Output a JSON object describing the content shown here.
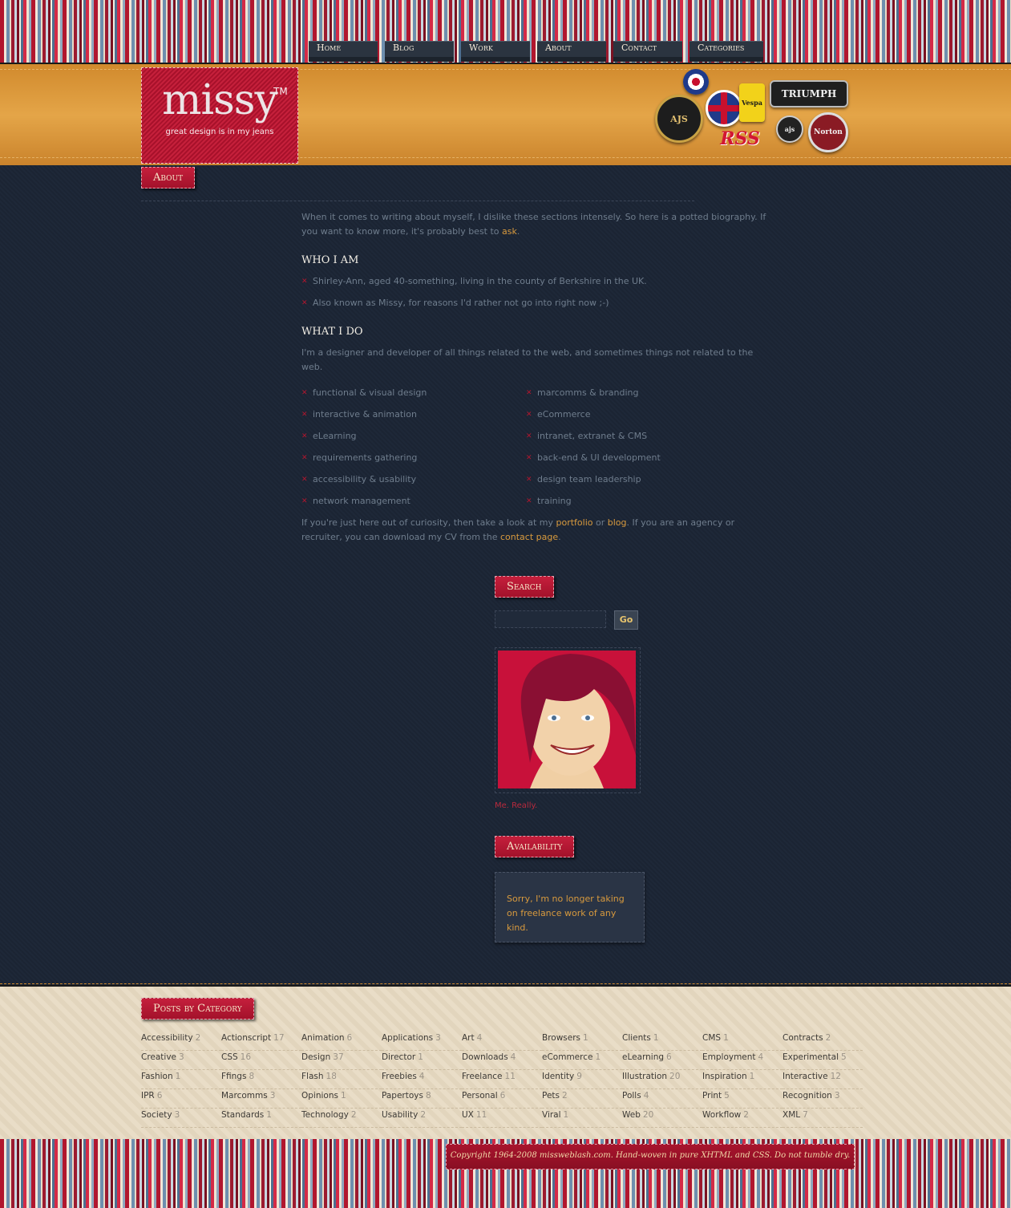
{
  "nav": [
    "Home",
    "Blog",
    "Work",
    "About",
    "Contact",
    "Categories"
  ],
  "logo": {
    "word": "missy",
    "tm": "TM",
    "tagline": "great design is in my jeans"
  },
  "badges": {
    "triumph": "TRIUMPH",
    "rss": "RSS",
    "norton": "Norton",
    "ajs": "AJS",
    "vespa": "Vespa"
  },
  "page_title": "About",
  "intro": {
    "text": "When it comes to writing about myself, I dislike these sections intensely. So here is a potted biography. If you want to know more, it's probably best to ",
    "link": "ask",
    "after": "."
  },
  "who": {
    "heading": "WHO I AM",
    "items": [
      "Shirley-Ann, aged 40-something, living in the county of Berkshire in the UK.",
      "Also known as Missy, for reasons I'd rather not go into right now ;-)"
    ]
  },
  "what": {
    "heading": "WHAT I DO",
    "text": "I'm a designer and developer of all things related to the web, and sometimes things not related to the web.",
    "left": [
      "functional & visual design",
      "interactive & animation",
      "eLearning",
      "requirements gathering",
      "accessibility & usability",
      "network management"
    ],
    "right": [
      "marcomms & branding",
      "eCommerce",
      "intranet, extranet & CMS",
      "back-end & UI development",
      "design team leadership",
      "training"
    ]
  },
  "outro": {
    "t1": "If you're just here out of curiosity, then take a look at my ",
    "l1": "portfolio",
    "t2": " or ",
    "l2": "blog",
    "t3": ". If you are an agency or recruiter, you can download my CV from the ",
    "l3": "contact page",
    "t4": "."
  },
  "sidebar": {
    "search_title": "Search",
    "go": "Go",
    "caption": "Me. Really.",
    "avail_title": "Availability",
    "avail_text": "Sorry, I'm no longer taking on freelance work of any kind."
  },
  "categories_title": "Posts by Category",
  "categories": [
    [
      "Accessibility",
      "2"
    ],
    [
      "Actionscript",
      "17"
    ],
    [
      "Animation",
      "6"
    ],
    [
      "Applications",
      "3"
    ],
    [
      "Art",
      "4"
    ],
    [
      "Browsers",
      "1"
    ],
    [
      "Clients",
      "1"
    ],
    [
      "CMS",
      "1"
    ],
    [
      "Contracts",
      "2"
    ],
    [
      "Creative",
      "3"
    ],
    [
      "CSS",
      "16"
    ],
    [
      "Design",
      "37"
    ],
    [
      "Director",
      "1"
    ],
    [
      "Downloads",
      "4"
    ],
    [
      "eCommerce",
      "1"
    ],
    [
      "eLearning",
      "6"
    ],
    [
      "Employment",
      "4"
    ],
    [
      "Experimental",
      "5"
    ],
    [
      "Fashion",
      "1"
    ],
    [
      "Ffings",
      "8"
    ],
    [
      "Flash",
      "18"
    ],
    [
      "Freebies",
      "4"
    ],
    [
      "Freelance",
      "11"
    ],
    [
      "Identity",
      "9"
    ],
    [
      "Illustration",
      "20"
    ],
    [
      "Inspiration",
      "1"
    ],
    [
      "Interactive",
      "12"
    ],
    [
      "IPR",
      "6"
    ],
    [
      "Marcomms",
      "3"
    ],
    [
      "Opinions",
      "1"
    ],
    [
      "Papertoys",
      "8"
    ],
    [
      "Personal",
      "6"
    ],
    [
      "Pets",
      "2"
    ],
    [
      "Polls",
      "4"
    ],
    [
      "Print",
      "5"
    ],
    [
      "Recognition",
      "3"
    ],
    [
      "Society",
      "3"
    ],
    [
      "Standards",
      "1"
    ],
    [
      "Technology",
      "2"
    ],
    [
      "Usability",
      "2"
    ],
    [
      "UX",
      "11"
    ],
    [
      "Viral",
      "1"
    ],
    [
      "Web",
      "20"
    ],
    [
      "Workflow",
      "2"
    ],
    [
      "XML",
      "7"
    ]
  ],
  "copyright": "Copyright 1964-2008 missweblash.com. Hand-woven in pure XHTML and CSS. Do not tumble dry."
}
